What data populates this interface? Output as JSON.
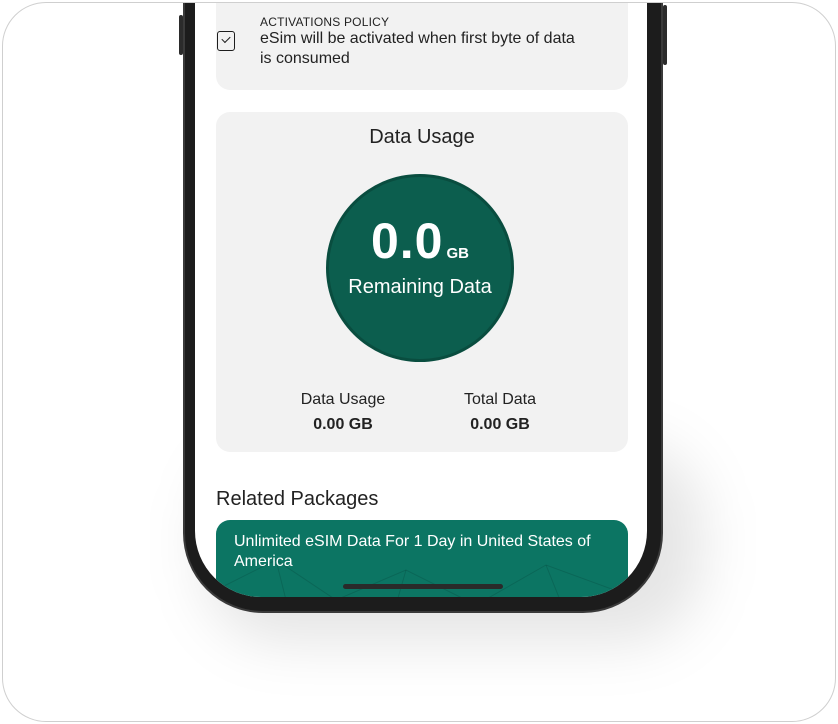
{
  "activation_policy": {
    "title": "ACTIVATIONS POLICY",
    "text": "eSim will be activated when first byte of data is consumed"
  },
  "data_usage": {
    "heading": "Data Usage",
    "remaining_value": "0.0",
    "remaining_unit": "GB",
    "remaining_label": "Remaining Data",
    "usage_label": "Data Usage",
    "usage_value": "0.00 GB",
    "total_label": "Total Data",
    "total_value": "0.00 GB"
  },
  "related": {
    "heading": "Related Packages",
    "packages": [
      {
        "title": "Unlimited eSIM Data For  1 Day in  United States of America"
      }
    ]
  },
  "colors": {
    "brand_green": "#0c5e4e",
    "package_green": "#0c7563",
    "card_background": "#f2f2f2"
  }
}
